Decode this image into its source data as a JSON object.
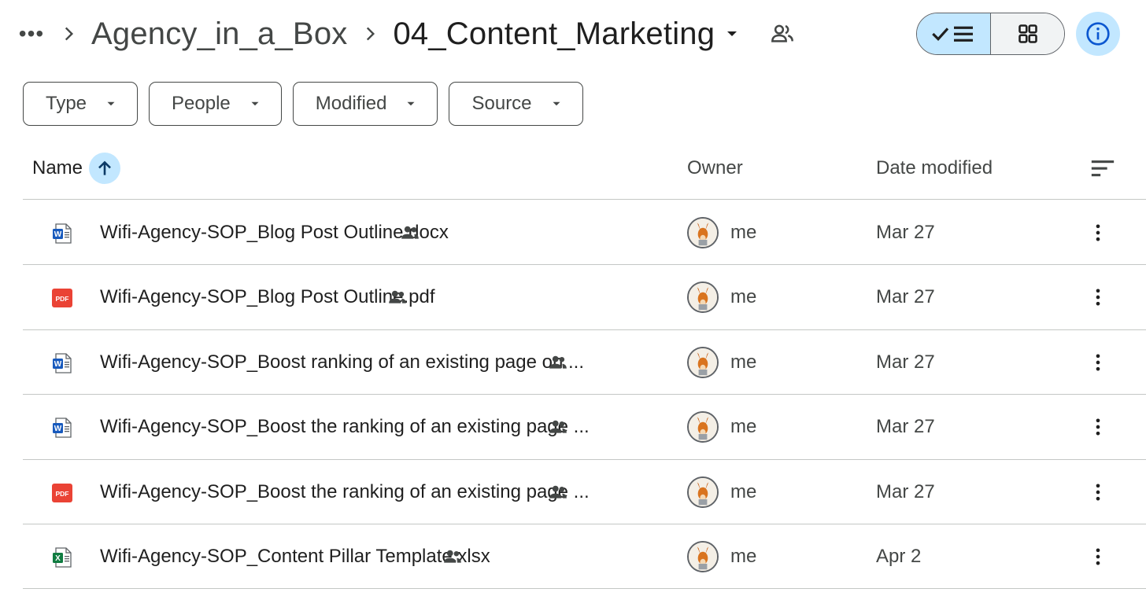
{
  "breadcrumb": {
    "more_label": "•••",
    "parent": "Agency_in_a_Box",
    "current": "04_Content_Marketing"
  },
  "filters": [
    {
      "label": "Type"
    },
    {
      "label": "People"
    },
    {
      "label": "Modified"
    },
    {
      "label": "Source"
    }
  ],
  "table": {
    "columns": {
      "name": "Name",
      "owner": "Owner",
      "date": "Date modified"
    },
    "rows": [
      {
        "type": "word",
        "name": "Wifi-Agency-SOP_Blog Post Outline.docx",
        "owner": "me",
        "date": "Mar 27"
      },
      {
        "type": "pdf",
        "name": "Wifi-Agency-SOP_Blog Post Outline.pdf",
        "owner": "me",
        "date": "Mar 27"
      },
      {
        "type": "word",
        "name": "Wifi-Agency-SOP_Boost ranking of an existing page on ...",
        "owner": "me",
        "date": "Mar 27"
      },
      {
        "type": "word",
        "name": "Wifi-Agency-SOP_Boost the ranking of an existing page ...",
        "owner": "me",
        "date": "Mar 27"
      },
      {
        "type": "pdf",
        "name": "Wifi-Agency-SOP_Boost the ranking of an existing page ...",
        "owner": "me",
        "date": "Mar 27"
      },
      {
        "type": "excel",
        "name": "Wifi-Agency-SOP_Content Pillar Template.xlsx",
        "owner": "me",
        "date": "Apr 2"
      }
    ]
  },
  "icons": {
    "word": "word-doc-icon",
    "pdf": "pdf-file-icon",
    "excel": "excel-sheet-icon",
    "shared": "shared-people-icon"
  },
  "colors": {
    "accent_light": "#c2e7ff",
    "word_blue": "#185abd",
    "pdf_red": "#ea4335",
    "excel_green": "#107c41"
  }
}
